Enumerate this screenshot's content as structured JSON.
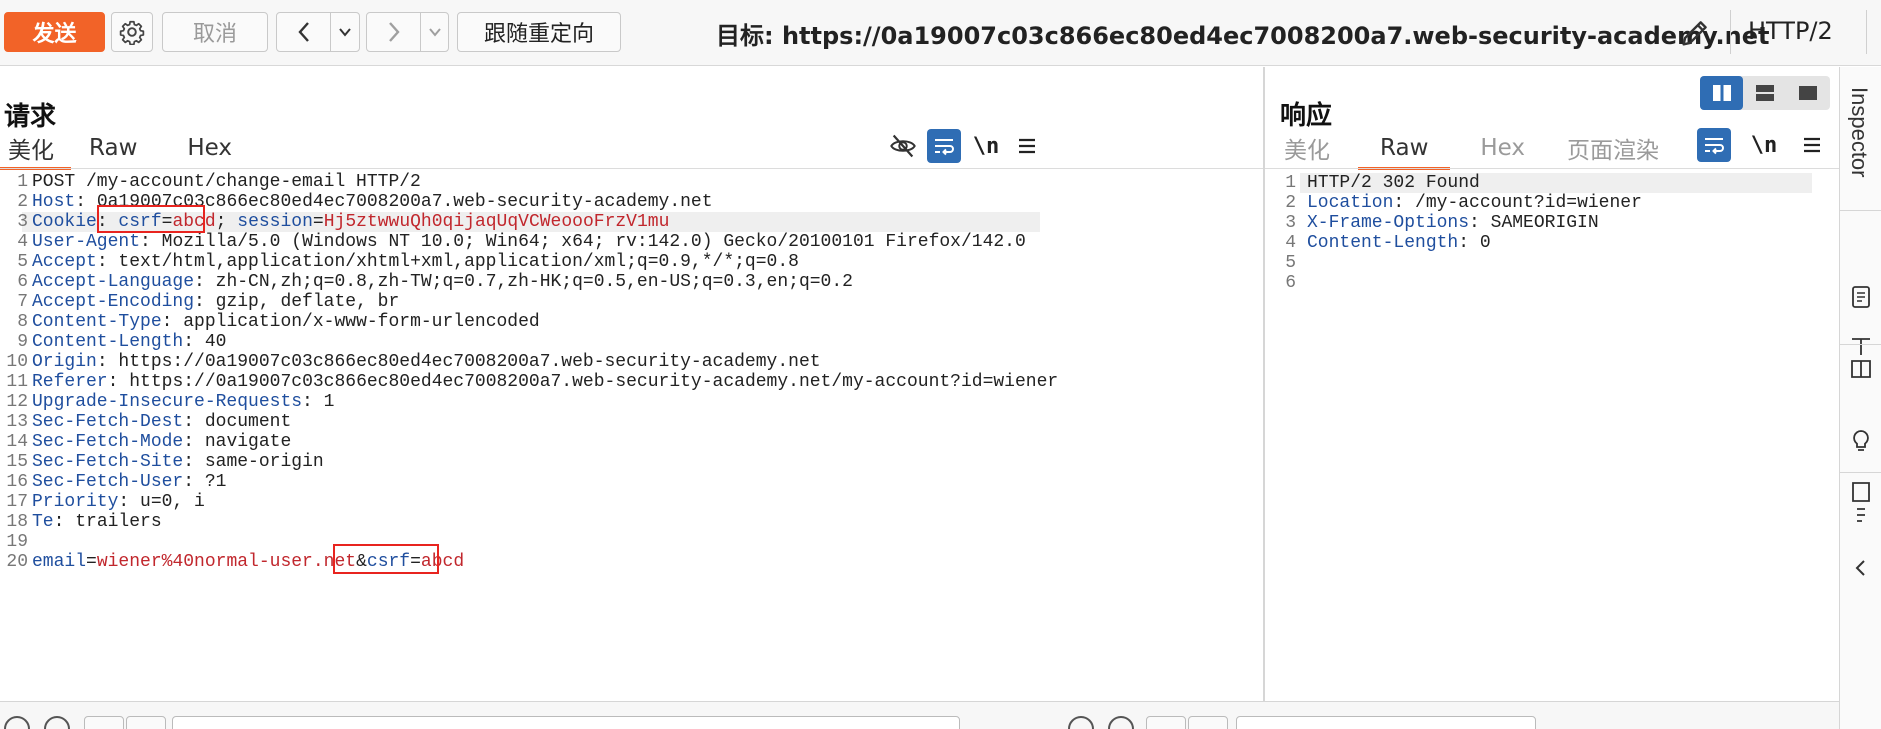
{
  "toolbar": {
    "send_label": "发送",
    "cancel_label": "取消",
    "follow_redirect_label": "跟随重定向",
    "target_text": "目标: https://0a19007c03c866ec80ed4ec7008200a7.web-security-academy.net",
    "http_version": "HTTP/2"
  },
  "layout_icons": [
    "split-horizontal-icon",
    "split-vertical-icon",
    "single-pane-icon"
  ],
  "request": {
    "title": "请求",
    "tabs": [
      {
        "label": "美化",
        "active": true
      },
      {
        "label": "Raw",
        "active": false
      },
      {
        "label": "Hex",
        "active": false
      }
    ],
    "tool_icons": [
      "eye-slash-icon",
      "wrap-icon",
      "newline-icon",
      "menu-icon"
    ],
    "newline_label": "\\n",
    "line_numbers": [
      "1",
      "2",
      "3",
      "4",
      "5",
      "6",
      "7",
      "8",
      "9",
      "10",
      "11",
      "12",
      "13",
      "14",
      "15",
      "16",
      "17",
      "18",
      "19",
      "20"
    ],
    "lines": {
      "l1": "POST /my-account/change-email HTTP/2",
      "l2_name": "Host",
      "l2_val": " 0a19007c03c866ec80ed4ec7008200a7.web-security-academy.net",
      "l3_name": "Cookie",
      "l3_c1_name": "csrf",
      "l3_c1_val": "abcd",
      "l3_c2_name": "session",
      "l3_c2_val": "Hj5ztwwuQh0qijaqUqVCWeoooFrzV1mu",
      "l4_name": "User-Agent",
      "l4_val": " Mozilla/5.0 (Windows NT 10.0; Win64; x64; rv:142.0) Gecko/20100101 Firefox/142.0",
      "l5_name": "Accept",
      "l5_val": " text/html,application/xhtml+xml,application/xml;q=0.9,*/*;q=0.8",
      "l6_name": "Accept-Language",
      "l6_val": " zh-CN,zh;q=0.8,zh-TW;q=0.7,zh-HK;q=0.5,en-US;q=0.3,en;q=0.2",
      "l7_name": "Accept-Encoding",
      "l7_val": " gzip, deflate, br",
      "l8_name": "Content-Type",
      "l8_val": " application/x-www-form-urlencoded",
      "l9_name": "Content-Length",
      "l9_val": " 40",
      "l10_name": "Origin",
      "l10_val": " https://0a19007c03c866ec80ed4ec7008200a7.web-security-academy.net",
      "l11_name": "Referer",
      "l11_val": " https://0a19007c03c866ec80ed4ec7008200a7.web-security-academy.net/my-account?id=wiener",
      "l12_name": "Upgrade-Insecure-Requests",
      "l12_val": " 1",
      "l13_name": "Sec-Fetch-Dest",
      "l13_val": " document",
      "l14_name": "Sec-Fetch-Mode",
      "l14_val": " navigate",
      "l15_name": "Sec-Fetch-Site",
      "l15_val": " same-origin",
      "l16_name": "Sec-Fetch-User",
      "l16_val": " ?1",
      "l17_name": "Priority",
      "l17_val": " u=0, i",
      "l18_name": "Te",
      "l18_val": " trailers",
      "l20_p1_name": "email",
      "l20_p1_val": "wiener%40normal-user.net",
      "l20_p2_name": "csrf",
      "l20_p2_val": "abcd"
    }
  },
  "response": {
    "title": "响应",
    "tabs": [
      {
        "label": "美化",
        "active": false
      },
      {
        "label": "Raw",
        "active": true
      },
      {
        "label": "Hex",
        "active": false
      },
      {
        "label": "页面渲染",
        "active": false
      }
    ],
    "newline_label": "\\n",
    "line_numbers": [
      "1",
      "2",
      "3",
      "4",
      "5",
      "6"
    ],
    "lines": {
      "l1": "HTTP/2 302 Found",
      "l2_name": "Location",
      "l2_val": " /my-account?id=wiener",
      "l3_name": "X-Frame-Options",
      "l3_val": " SAMEORIGIN",
      "l4_name": "Content-Length",
      "l4_val": " 0"
    }
  },
  "inspector": {
    "label": "Inspector"
  }
}
